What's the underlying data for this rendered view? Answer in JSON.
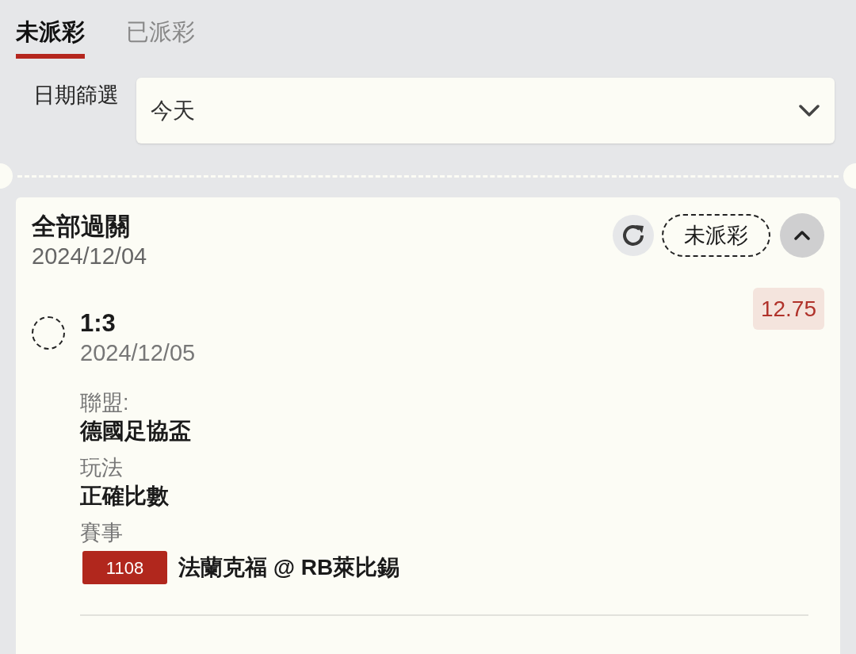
{
  "tabs": [
    {
      "label": "未派彩",
      "selected": true
    },
    {
      "label": "已派彩",
      "selected": false
    }
  ],
  "date_filter": {
    "label": "日期篩選",
    "value": "今天"
  },
  "ticket": {
    "title": "全部過關",
    "date": "2024/12/04",
    "status": "未派彩",
    "expanded": true,
    "legs": [
      {
        "selection": "1:3",
        "date": "2024/12/05",
        "odds": "12.75",
        "checked": false,
        "fields": [
          {
            "label": "聯盟:",
            "value": "德國足協盃"
          },
          {
            "label": "玩法",
            "value": "正確比數"
          }
        ],
        "match_label": "賽事",
        "match_code": "1108",
        "match_teams": "法蘭克福 @ RB萊比錫"
      }
    ]
  }
}
